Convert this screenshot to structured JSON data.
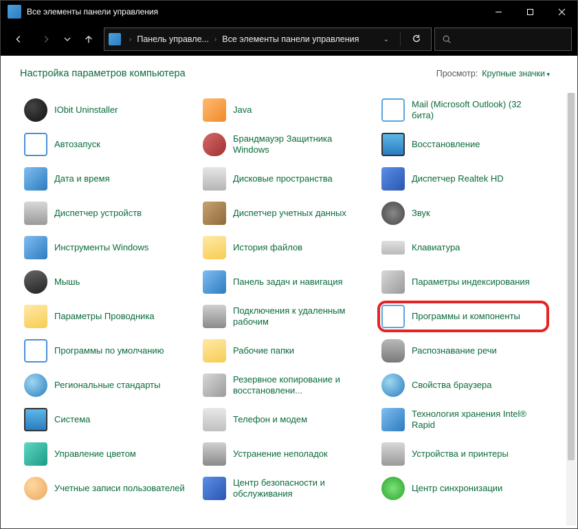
{
  "titlebar": {
    "title": "Все элементы панели управления"
  },
  "breadcrumb": {
    "seg1": "Панель управле...",
    "seg2": "Все элементы панели управления"
  },
  "heading": "Настройка параметров компьютера",
  "view": {
    "label": "Просмотр:",
    "value": "Крупные значки"
  },
  "items": [
    {
      "label": "IObit Uninstaller",
      "icon": "ic-dark",
      "name": "item-iobit-uninstaller",
      "highlight": false
    },
    {
      "label": "Java",
      "icon": "ic-orange",
      "name": "item-java",
      "highlight": false
    },
    {
      "label": "Mail (Microsoft Outlook) (32 бита)",
      "icon": "ic-box",
      "name": "item-mail-outlook",
      "highlight": false
    },
    {
      "label": "Автозапуск",
      "icon": "ic-window",
      "name": "item-autorun",
      "highlight": false
    },
    {
      "label": "Брандмауэр Защитника Windows",
      "icon": "ic-shield",
      "name": "item-defender-firewall",
      "highlight": false
    },
    {
      "label": "Восстановление",
      "icon": "ic-monitor",
      "name": "item-recovery",
      "highlight": false
    },
    {
      "label": "Дата и время",
      "icon": "ic-blue",
      "name": "item-date-time",
      "highlight": false
    },
    {
      "label": "Дисковые пространства",
      "icon": "ic-disk",
      "name": "item-storage-spaces",
      "highlight": false
    },
    {
      "label": "Диспетчер Realtek HD",
      "icon": "ic-realtek",
      "name": "item-realtek-hd",
      "highlight": false
    },
    {
      "label": "Диспетчер устройств",
      "icon": "ic-printer",
      "name": "item-device-manager",
      "highlight": false
    },
    {
      "label": "Диспетчер учетных данных",
      "icon": "ic-brown",
      "name": "item-credential-manager",
      "highlight": false
    },
    {
      "label": "Звук",
      "icon": "ic-speaker",
      "name": "item-sound",
      "highlight": false
    },
    {
      "label": "Инструменты Windows",
      "icon": "ic-blue",
      "name": "item-windows-tools",
      "highlight": false
    },
    {
      "label": "История файлов",
      "icon": "ic-folder",
      "name": "item-file-history",
      "highlight": false
    },
    {
      "label": "Клавиатура",
      "icon": "ic-kbd",
      "name": "item-keyboard",
      "highlight": false
    },
    {
      "label": "Мышь",
      "icon": "ic-mouse",
      "name": "item-mouse",
      "highlight": false
    },
    {
      "label": "Панель задач и навигация",
      "icon": "ic-blue",
      "name": "item-taskbar-navigation",
      "highlight": false
    },
    {
      "label": "Параметры индексирования",
      "icon": "ic-grey",
      "name": "item-indexing-options",
      "highlight": false
    },
    {
      "label": "Параметры Проводника",
      "icon": "ic-folder",
      "name": "item-explorer-options",
      "highlight": false
    },
    {
      "label": "Подключения к удаленным рабочим",
      "icon": "ic-wrench",
      "name": "item-remoteapp-connections",
      "highlight": false
    },
    {
      "label": "Программы и компоненты",
      "icon": "ic-box",
      "name": "item-programs-and-features",
      "highlight": true
    },
    {
      "label": "Программы по умолчанию",
      "icon": "ic-window",
      "name": "item-default-programs",
      "highlight": false
    },
    {
      "label": "Рабочие папки",
      "icon": "ic-folder",
      "name": "item-work-folders",
      "highlight": false
    },
    {
      "label": "Распознавание речи",
      "icon": "ic-mic",
      "name": "item-speech-recognition",
      "highlight": false
    },
    {
      "label": "Региональные стандарты",
      "icon": "ic-globe",
      "name": "item-region",
      "highlight": false
    },
    {
      "label": "Резервное копирование и восстановлени...",
      "icon": "ic-grey",
      "name": "item-backup-restore",
      "highlight": false
    },
    {
      "label": "Свойства браузера",
      "icon": "ic-globe",
      "name": "item-internet-options",
      "highlight": false
    },
    {
      "label": "Система",
      "icon": "ic-monitor",
      "name": "item-system",
      "highlight": false
    },
    {
      "label": "Телефон и модем",
      "icon": "ic-phone",
      "name": "item-phone-modem",
      "highlight": false
    },
    {
      "label": "Технология хранения Intel® Rapid",
      "icon": "ic-blue",
      "name": "item-intel-rapid-storage",
      "highlight": false
    },
    {
      "label": "Управление цветом",
      "icon": "ic-teal",
      "name": "item-color-management",
      "highlight": false
    },
    {
      "label": "Устранение неполадок",
      "icon": "ic-wrench",
      "name": "item-troubleshooting",
      "highlight": false
    },
    {
      "label": "Устройства и принтеры",
      "icon": "ic-printer",
      "name": "item-devices-printers",
      "highlight": false
    },
    {
      "label": "Учетные записи пользователей",
      "icon": "ic-users",
      "name": "item-user-accounts",
      "highlight": false
    },
    {
      "label": "Центр безопасности и обслуживания",
      "icon": "ic-flag",
      "name": "item-security-maintenance",
      "highlight": false
    },
    {
      "label": "Центр синхронизации",
      "icon": "ic-sync",
      "name": "item-sync-center",
      "highlight": false
    }
  ]
}
